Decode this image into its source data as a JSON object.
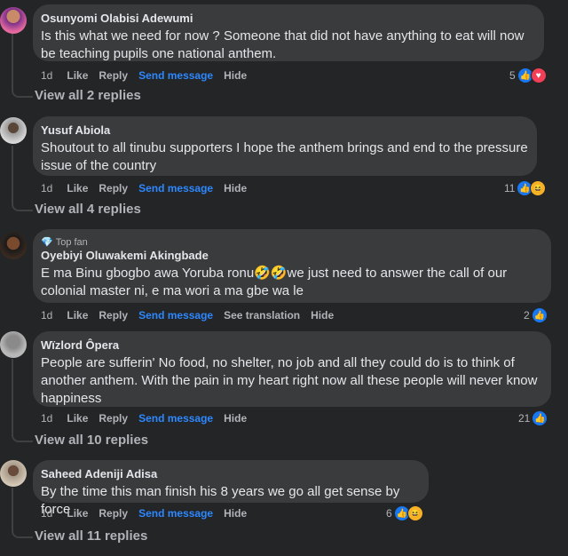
{
  "comments": [
    {
      "author": "Osunyomi Olabisi Adewumi",
      "text": "Is this what we need for now ? Someone that did not have anything to eat will now be teaching pupils one national anthem.",
      "time": "1d",
      "like": "Like",
      "reply": "Reply",
      "send": "Send message",
      "hide": "Hide",
      "reactions": "5",
      "view_replies": "View all 2 replies"
    },
    {
      "author": "Yusuf Abiola",
      "text": "Shoutout to all tinubu supporters I hope the anthem brings and end to the pressure issue of the country",
      "time": "1d",
      "like": "Like",
      "reply": "Reply",
      "send": "Send message",
      "hide": "Hide",
      "reactions": "11",
      "view_replies": "View all 4 replies"
    },
    {
      "badge": "Top fan",
      "author": "Oyebiyi Oluwakemi Akingbade",
      "text": "E ma Binu gbogbo awa Yoruba ronu🤣🤣we just need to answer the call of our colonial master ni, e ma wori a ma gbe wa le",
      "time": "1d",
      "like": "Like",
      "reply": "Reply",
      "send": "Send message",
      "translate": "See translation",
      "hide": "Hide",
      "reactions": "2"
    },
    {
      "author": "Wïzlord Ôpera",
      "text": "People are sufferin' No food, no shelter, no job and all they could do is to think of another anthem. With the pain in my heart right now all these people will never know happiness",
      "time": "1d",
      "like": "Like",
      "reply": "Reply",
      "send": "Send message",
      "hide": "Hide",
      "reactions": "21",
      "view_replies": "View all 10 replies"
    },
    {
      "author": "Saheed Adeniji Adisa",
      "text": "By the time this man finish his 8 years we go all get sense by force",
      "time": "1d",
      "like": "Like",
      "reply": "Reply",
      "send": "Send message",
      "hide": "Hide",
      "reactions": "6",
      "view_replies": "View all 11 replies"
    }
  ],
  "colors": {
    "background": "#242526",
    "bubble": "#3a3b3c",
    "link": "#2d88ff",
    "like": "#1877f2",
    "love": "#f33e58"
  },
  "icons": [
    "like-icon",
    "love-icon",
    "haha-icon",
    "top-fan-icon"
  ]
}
